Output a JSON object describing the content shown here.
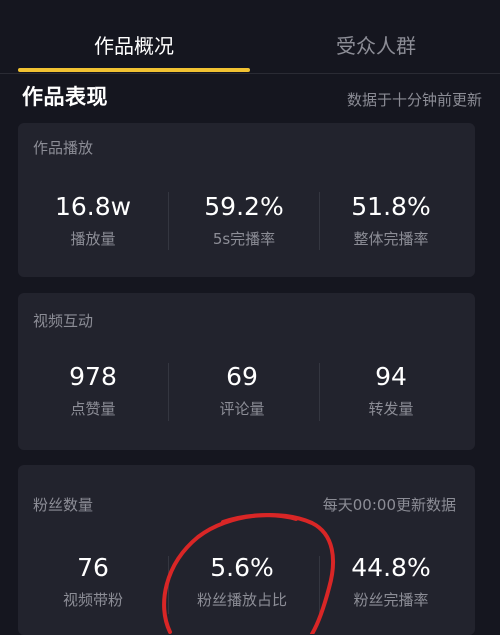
{
  "tabs": [
    {
      "label": "作品概况"
    },
    {
      "label": "受众人群"
    }
  ],
  "overview": {
    "title": "作品表现",
    "subtitle": "数据于十分钟前更新"
  },
  "cards": {
    "play": {
      "title": "作品播放",
      "metrics": [
        {
          "value": "16.8w",
          "label": "播放量"
        },
        {
          "value": "59.2%",
          "label": "5s完播率"
        },
        {
          "value": "51.8%",
          "label": "整体完播率"
        }
      ]
    },
    "interaction": {
      "title": "视频互动",
      "metrics": [
        {
          "value": "978",
          "label": "点赞量"
        },
        {
          "value": "69",
          "label": "评论量"
        },
        {
          "value": "94",
          "label": "转发量"
        }
      ]
    },
    "fans": {
      "title": "粉丝数量",
      "note": "每天00:00更新数据",
      "metrics": [
        {
          "value": "76",
          "label": "视频带粉"
        },
        {
          "value": "5.6%",
          "label": "粉丝播放占比"
        },
        {
          "value": "44.8%",
          "label": "粉丝完播率"
        }
      ]
    }
  },
  "colors": {
    "background": "#15161f",
    "card": "#22232d",
    "accent": "#f1c232",
    "annotation": "#d92626"
  }
}
